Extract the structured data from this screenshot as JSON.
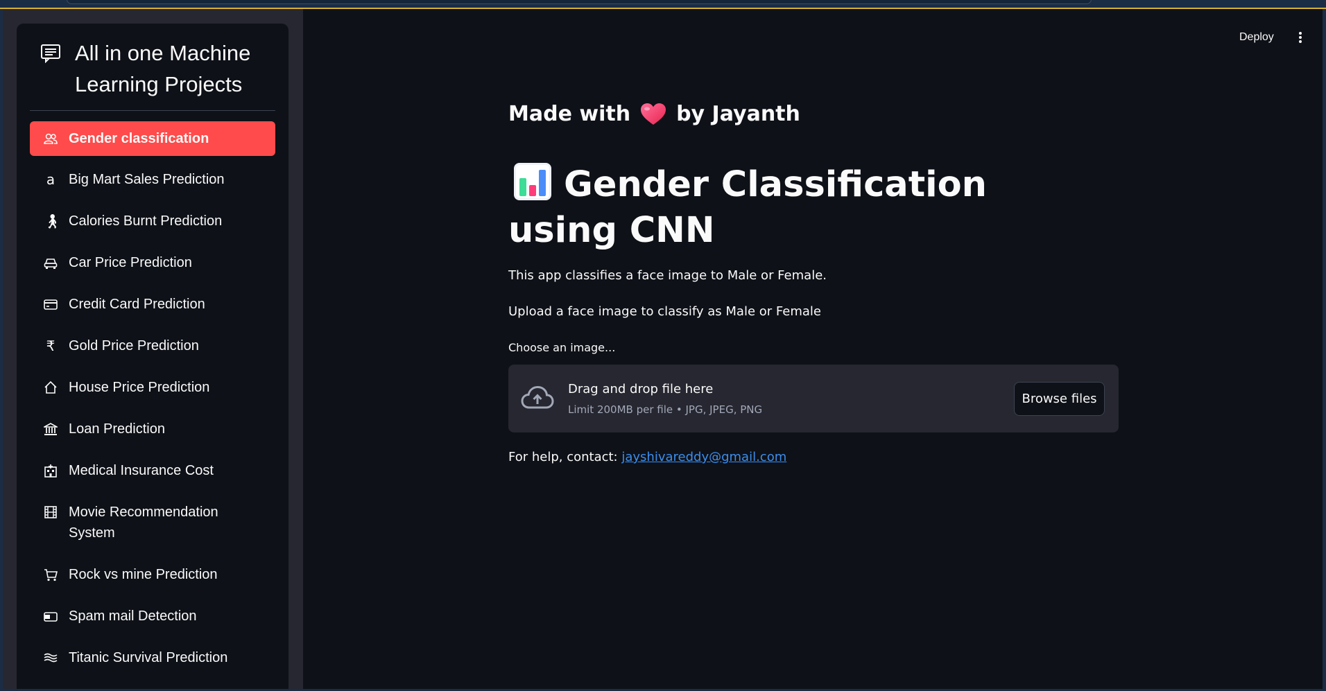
{
  "app": {
    "deploy_label": "Deploy"
  },
  "sidebar": {
    "title": "All in one Machine Learning Projects",
    "items": [
      {
        "label": "Gender classification",
        "icon": "people-icon",
        "active": true
      },
      {
        "label": "Big Mart Sales Prediction",
        "icon": "amazon-icon",
        "active": false
      },
      {
        "label": "Calories Burnt Prediction",
        "icon": "person-walking-icon",
        "active": false
      },
      {
        "label": "Car Price Prediction",
        "icon": "car-icon",
        "active": false
      },
      {
        "label": "Credit Card Prediction",
        "icon": "credit-card-icon",
        "active": false
      },
      {
        "label": "Gold Price Prediction",
        "icon": "rupee-icon",
        "active": false
      },
      {
        "label": "House Price Prediction",
        "icon": "house-icon",
        "active": false
      },
      {
        "label": "Loan Prediction",
        "icon": "bank-icon",
        "active": false
      },
      {
        "label": "Medical Insurance Cost",
        "icon": "hospital-icon",
        "active": false
      },
      {
        "label": "Movie Recommendation System",
        "icon": "film-icon",
        "active": false
      },
      {
        "label": "Rock vs mine Prediction",
        "icon": "cart-icon",
        "active": false
      },
      {
        "label": "Spam mail Detection",
        "icon": "wallet-icon",
        "active": false
      },
      {
        "label": "Titanic Survival Prediction",
        "icon": "water-icon",
        "active": false
      }
    ],
    "accent_color": "#ff4b4b"
  },
  "main": {
    "made_with_prefix": "Made with",
    "made_with_suffix": "by Jayanth",
    "title": "Gender Classification using CNN",
    "description": "This app classifies a face image to Male or Female.",
    "instruction": "Upload a face image to classify as Male or Female",
    "uploader": {
      "label": "Choose an image...",
      "drop_text": "Drag and drop file here",
      "limit_text": "Limit 200MB per file • JPG, JPEG, PNG",
      "browse_label": "Browse files"
    },
    "help_prefix": "For help, contact:",
    "help_email": "jayshivareddy@gmail.com"
  }
}
